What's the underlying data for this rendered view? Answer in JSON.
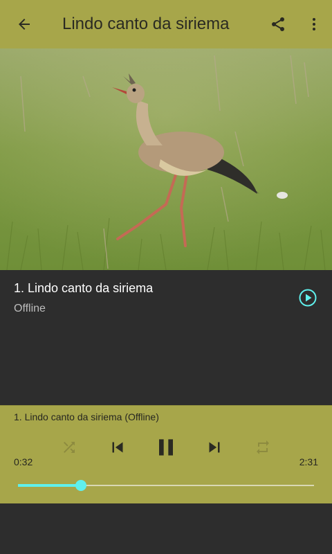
{
  "toolbar": {
    "title": "Lindo canto da siriema",
    "back_icon": "arrow-left-icon",
    "share_icon": "share-icon",
    "menu_icon": "more-vert-icon"
  },
  "hero": {
    "image": "seriema-bird-photo"
  },
  "tracks": [
    {
      "title": "1. Lindo canto da siriema",
      "status": "Offline",
      "icon": "play-circle-icon"
    }
  ],
  "player": {
    "now_playing": "1. Lindo canto da siriema (Offline)",
    "elapsed": "0:32",
    "duration": "2:31",
    "progress": 0.212,
    "playing": true
  },
  "colors": {
    "accent": "#a7a64a",
    "seek": "#5ff0ec",
    "background": "#2d2d2d"
  }
}
